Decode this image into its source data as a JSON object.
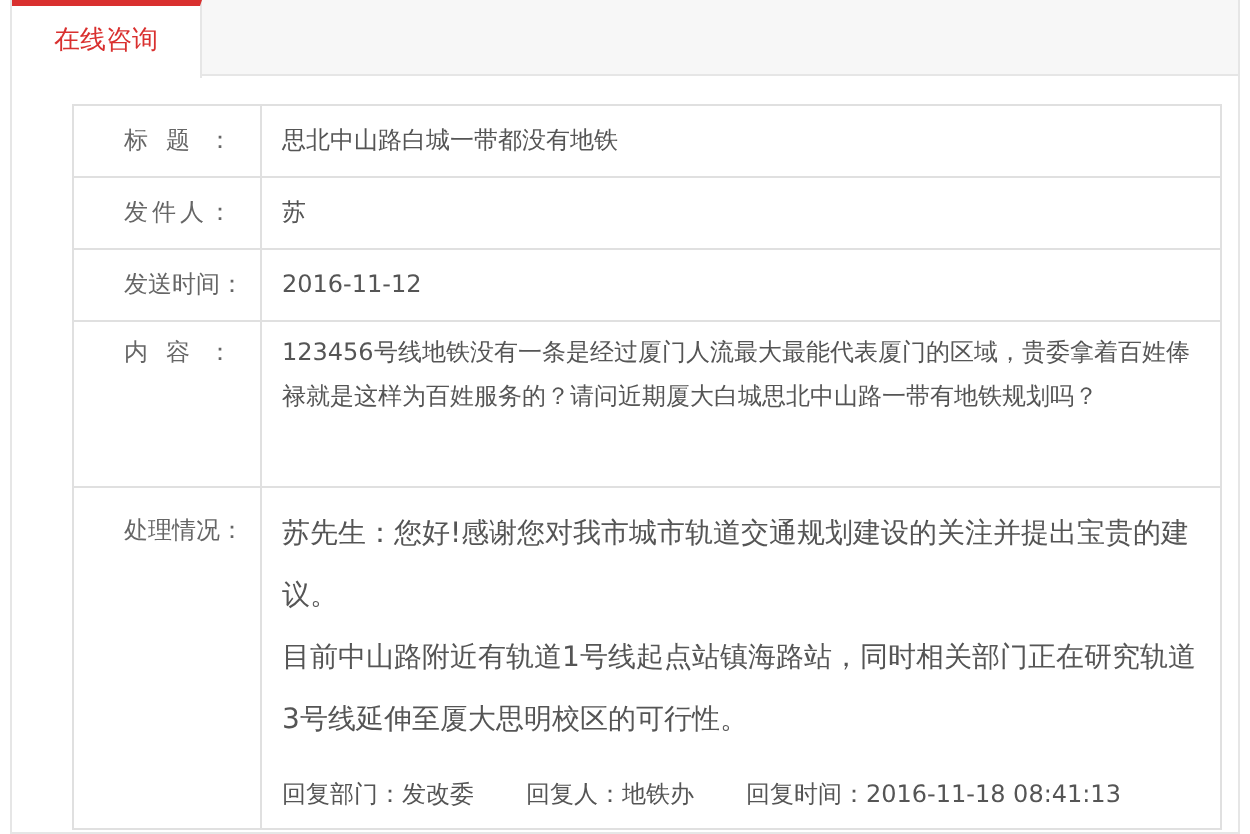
{
  "tabs": [
    {
      "label": "在线咨询",
      "selected": true
    }
  ],
  "fields": [
    {
      "label": "标题：",
      "value": "思北中山路白城一带都没有地铁",
      "kind": "line"
    },
    {
      "label": "发件人：",
      "value": "苏",
      "kind": "line"
    },
    {
      "label": "发送时间：",
      "value": "2016-11-12",
      "kind": "line"
    },
    {
      "label": "内容：",
      "value": "123456号线地铁没有一条是经过厦门人流最大最能代表厦门的区域，贵委拿着百姓俸禄就是这样为百姓服务的？请问近期厦大白城思北中山路一带有地铁规划吗？",
      "kind": "text"
    }
  ],
  "reply": {
    "label": "处理情况：",
    "paragraphs": [
      "苏先生：您好!感谢您对我市城市轨道交通规划建设的关注并提出宝贵的建议。",
      "目前中山路附近有轨道1号线起点站镇海路站，同时相关部门正在研究轨道3号线延伸至厦大思明校区的可行性。"
    ],
    "meta": [
      {
        "label": "回复部门：",
        "value": "发改委"
      },
      {
        "label": "回复人：",
        "value": "地铁办"
      },
      {
        "label": "回复时间：",
        "value": "2016-11-18 08:41:13"
      }
    ]
  }
}
